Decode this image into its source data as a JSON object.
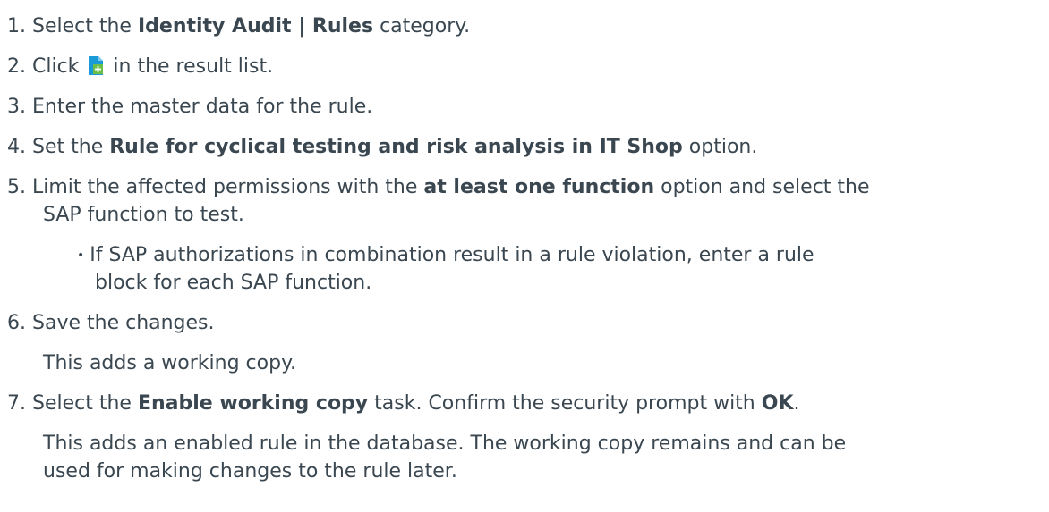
{
  "steps": [
    {
      "num": "1.",
      "parts": [
        "Select the ",
        "Identity Audit | Rules",
        " category."
      ]
    },
    {
      "num": "2.",
      "parts": [
        "Click ",
        " in the result list."
      ],
      "icon": "add-document-icon"
    },
    {
      "num": "3.",
      "parts": [
        "Enter the master data for the rule."
      ]
    },
    {
      "num": "4.",
      "parts": [
        "Set the ",
        "Rule for cyclical testing and risk analysis in IT Shop",
        " option."
      ]
    },
    {
      "num": "5.",
      "parts": [
        "Limit the affected permissions with the ",
        "at least one function",
        " option and select the"
      ],
      "line2": "SAP function to test.",
      "bullet": {
        "line1": "If SAP authorizations in combination result in a rule violation, enter a rule",
        "line2": "block for each SAP function."
      }
    },
    {
      "num": "6.",
      "parts": [
        "Save the changes."
      ],
      "result": "This adds a working copy."
    },
    {
      "num": "7.",
      "parts": [
        "Select the ",
        "Enable working copy",
        " task. Confirm the security prompt with ",
        "OK",
        "."
      ],
      "result_line1": "This adds an enabled rule in the database. The working copy remains and can be",
      "result_line2": "used for making changes to the rule later."
    }
  ],
  "colors": {
    "text": "#3a4750",
    "icon_blue": "#1a9ad6",
    "icon_green": "#6cc04a"
  }
}
